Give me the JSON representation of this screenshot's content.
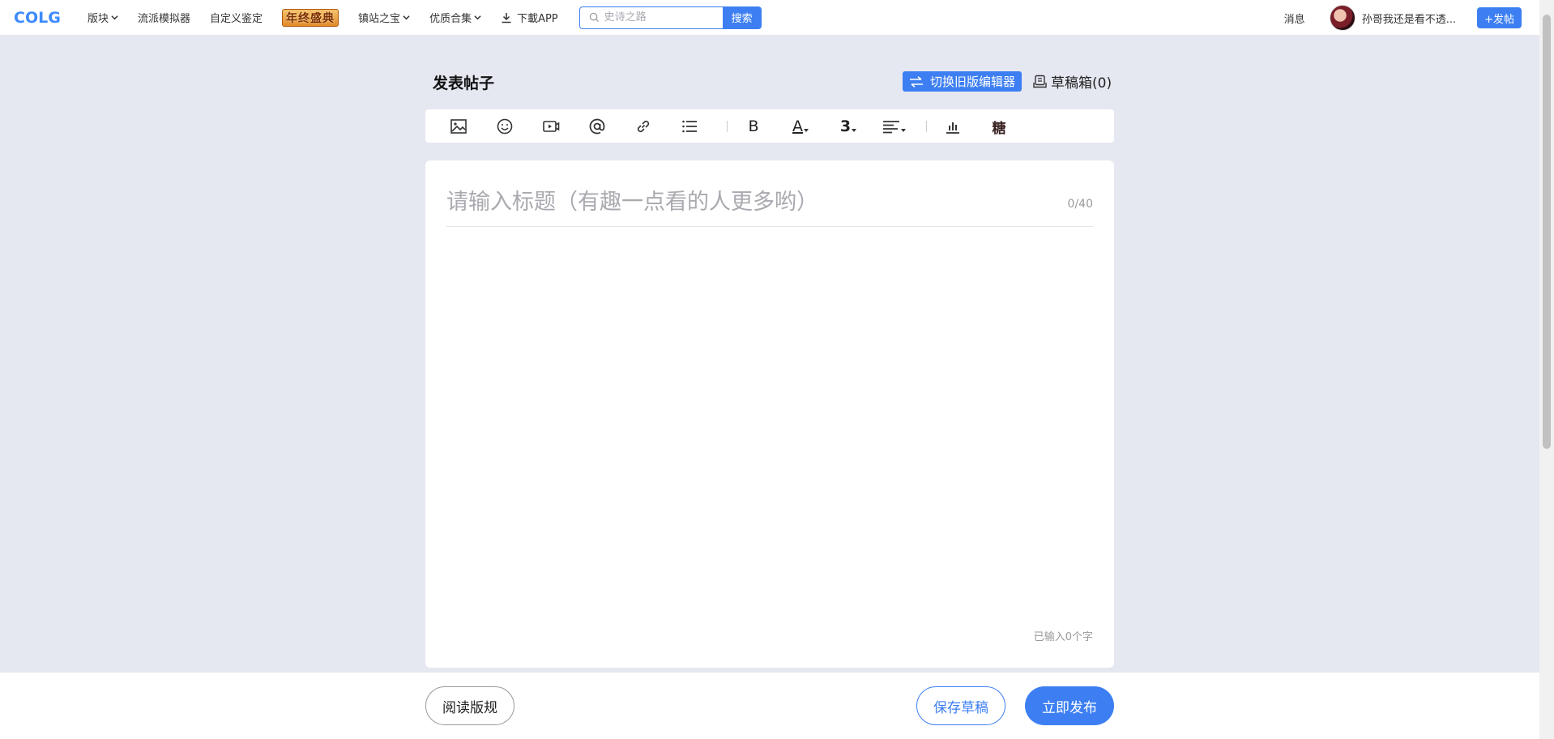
{
  "nav": {
    "logo": "COLG",
    "items": [
      {
        "label": "版块",
        "dropdown": true
      },
      {
        "label": "流派模拟器",
        "dropdown": false
      },
      {
        "label": "自定义鉴定",
        "dropdown": false
      }
    ],
    "festival_banner": "年终盛典",
    "items_after": [
      {
        "label": "镇站之宝",
        "dropdown": true
      },
      {
        "label": "优质合集",
        "dropdown": true
      }
    ],
    "download": "下載APP",
    "search_placeholder": "史诗之路",
    "search_button": "搜索",
    "messages": "消息",
    "username": "孙哥我还是看不透...",
    "post_button": "+发帖"
  },
  "header": {
    "title": "发表帖子",
    "switch_editor": "切换旧版编辑器",
    "drafts": "草稿箱(0)"
  },
  "toolbar": {
    "icons": [
      "image-icon",
      "emoji-icon",
      "video-icon",
      "mention-icon",
      "link-icon",
      "list-icon",
      "bold-icon",
      "font-color-icon",
      "font-size-icon",
      "align-icon",
      "chart-icon",
      "special-icon"
    ],
    "bold_label": "B",
    "font_color_label": "A",
    "font_size_label": "3",
    "special_label": "糖"
  },
  "editor": {
    "title_placeholder": "请输入标题（有趣一点看的人更多哟）",
    "title_count": "0/40",
    "char_count": "已输入0个字"
  },
  "footer": {
    "rules": "阅读版规",
    "save_draft": "保存草稿",
    "publish": "立即发布"
  },
  "colors": {
    "accent": "#3d7ff2",
    "background": "#e5e7f1"
  }
}
